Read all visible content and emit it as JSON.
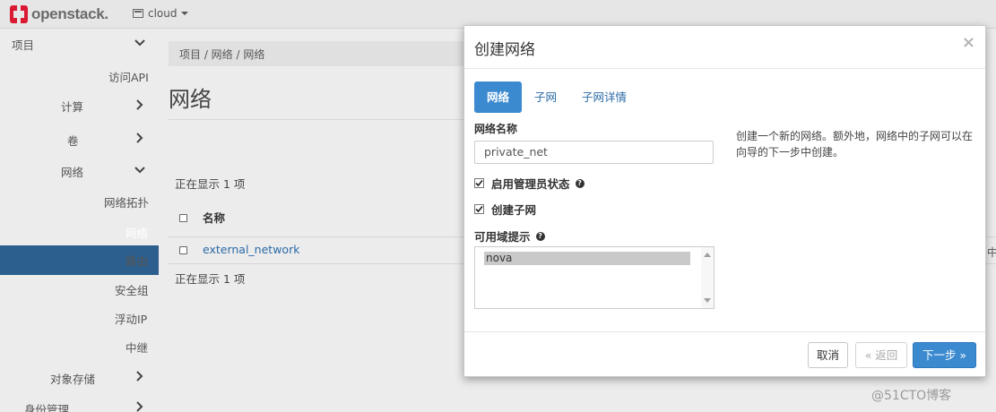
{
  "topbar": {
    "brand": "openstack.",
    "project": "cloud"
  },
  "sidebar": {
    "items": [
      {
        "label": "项目",
        "chevron": "down"
      },
      {
        "label": "访问API"
      },
      {
        "label": "计算",
        "chevron": "right"
      },
      {
        "label": "卷",
        "chevron": "right"
      },
      {
        "label": "网络",
        "chevron": "down"
      },
      {
        "label": "网络拓扑"
      },
      {
        "label": "网络",
        "active": true
      },
      {
        "label": "路由"
      },
      {
        "label": "安全组"
      },
      {
        "label": "浮动IP"
      },
      {
        "label": "中继"
      },
      {
        "label": "对象存储",
        "chevron": "right"
      },
      {
        "label": "身份管理",
        "chevron": "right"
      }
    ]
  },
  "page": {
    "breadcrumb": "项目 /  网络 /  网络",
    "title": "网络",
    "showing_top": "正在显示 1 项",
    "showing_bottom": "正在显示 1 项",
    "table": {
      "columns": [
        "名称"
      ],
      "rows": [
        {
          "name": "external_network"
        }
      ]
    },
    "clipped_text": "中"
  },
  "modal": {
    "title": "创建网络",
    "close": "×",
    "tabs": [
      "网络",
      "子网",
      "子网详情"
    ],
    "network_name_label": "网络名称",
    "network_name_value": "private_net",
    "admin_state_label": "启用管理员状态",
    "admin_state_checked": true,
    "create_subnet_label": "创建子网",
    "create_subnet_checked": true,
    "az_hint_label": "可用域提示",
    "az_options": [
      "nova"
    ],
    "az_selected": "nova",
    "help_text": "创建一个新的网络。额外地，网络中的子网可以在向导的下一步中创建。",
    "buttons": {
      "cancel": "取消",
      "back": "« 返回",
      "next": "下一步 »"
    }
  },
  "watermark": "@51CTO博客",
  "colors": {
    "accent": "#3b8ad0",
    "sidebar_active": "#2c5f8d",
    "link": "#2a6aa6",
    "brand_red": "#da1a32"
  }
}
